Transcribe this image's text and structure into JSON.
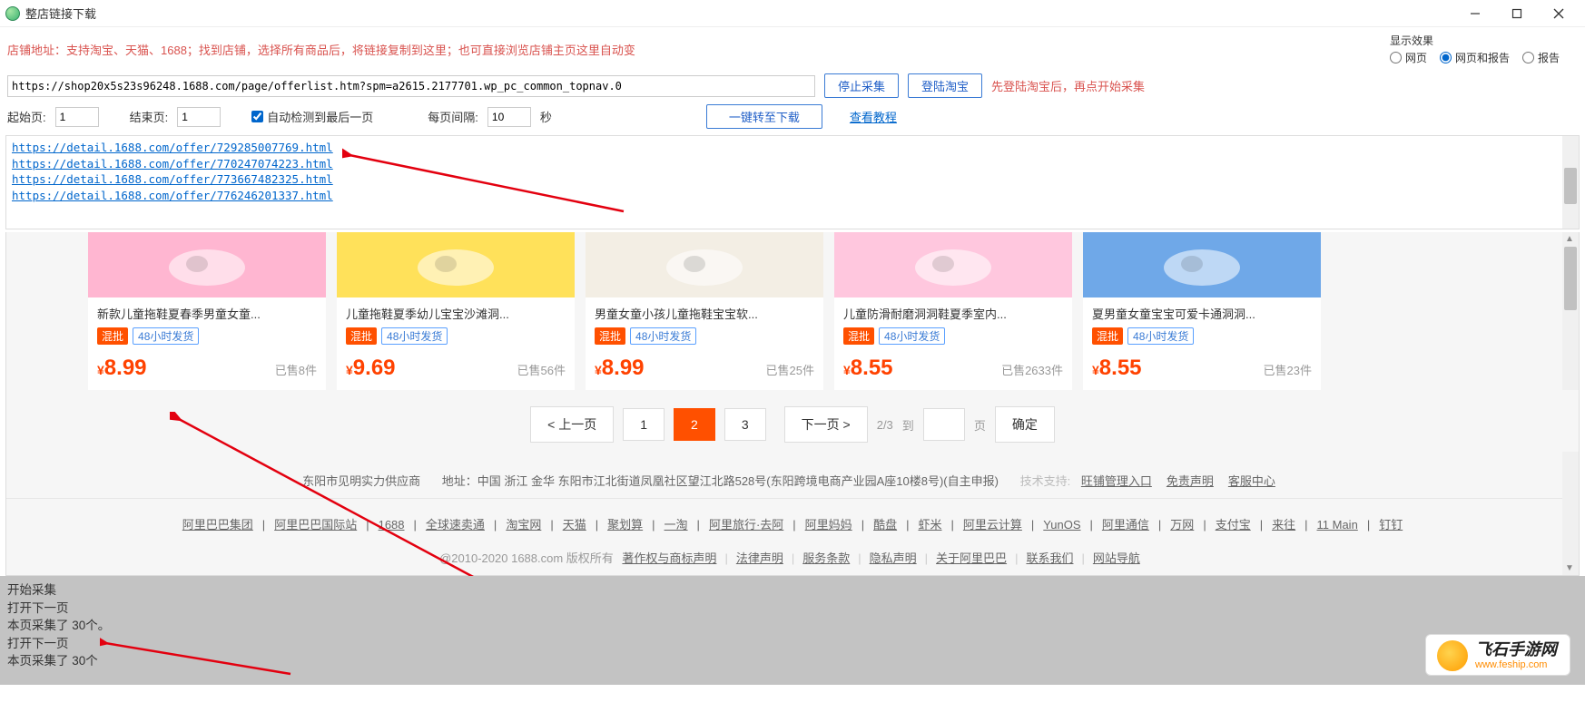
{
  "window": {
    "title": "整店链接下载"
  },
  "hint": "店铺地址：支持淘宝、天猫、1688；找到店铺，选择所有商品后，将链接复制到这里；也可直接浏览店铺主页这里自动变",
  "url_value": "https://shop20x5s23s96248.1688.com/page/offerlist.htm?spm=a2615.2177701.wp_pc_common_topnav.0",
  "buttons": {
    "stop": "停止采集",
    "login": "登陆淘宝",
    "transfer": "一键转至下载"
  },
  "login_hint": "先登陆淘宝后，再点开始采集",
  "display": {
    "label": "显示效果",
    "opt_web": "网页",
    "opt_web_report": "网页和报告",
    "opt_report": "报告",
    "selected": "opt_web_report"
  },
  "controls": {
    "start_page_label": "起始页:",
    "start_page": "1",
    "end_page_label": "结束页:",
    "end_page": "1",
    "auto_detect": "自动检测到最后一页",
    "interval_label": "每页间隔:",
    "interval": "10",
    "seconds": "秒",
    "view_tutorial": "查看教程"
  },
  "links": [
    "https://detail.1688.com/offer/776246201337.html",
    "https://detail.1688.com/offer/773667482325.html",
    "https://detail.1688.com/offer/770247074223.html",
    "https://detail.1688.com/offer/729285007769.html"
  ],
  "products": [
    {
      "title": "新款儿童拖鞋夏春季男童女童...",
      "tag1": "混批",
      "tag2": "48小时发货",
      "price": "8.99",
      "sold": "已售8件",
      "img": "pink"
    },
    {
      "title": "儿童拖鞋夏季幼儿宝宝沙滩洞...",
      "tag1": "混批",
      "tag2": "48小时发货",
      "price": "9.69",
      "sold": "已售56件",
      "img": "yellow"
    },
    {
      "title": "男童女童小孩儿童拖鞋宝宝软...",
      "tag1": "混批",
      "tag2": "48小时发货",
      "price": "8.99",
      "sold": "已售25件",
      "img": "white"
    },
    {
      "title": "儿童防滑耐磨洞洞鞋夏季室内...",
      "tag1": "混批",
      "tag2": "48小时发货",
      "price": "8.55",
      "sold": "已售2633件",
      "img": "pink2"
    },
    {
      "title": "夏男童女童宝宝可爱卡通洞洞...",
      "tag1": "混批",
      "tag2": "48小时发货",
      "price": "8.55",
      "sold": "已售23件",
      "img": "blue"
    }
  ],
  "pagination": {
    "prev": "< 上一页",
    "next": "下一页 >",
    "pages": [
      "1",
      "2",
      "3"
    ],
    "current": "2",
    "of": "2/3",
    "goto": "到",
    "page_suffix": "页",
    "confirm": "确定"
  },
  "footer": {
    "supplier": "东阳市见明实力供应商",
    "address_label": "地址：",
    "address": "中国 浙江 金华 东阳市江北街道凤凰社区望江北路528号(东阳跨境电商产业园A座10楼8号)(自主申报)",
    "tech_label": "技术支持:",
    "tech_links": [
      "旺铺管理入口",
      "免责声明",
      "客服中心"
    ]
  },
  "sitelinks": [
    "阿里巴巴集团",
    "阿里巴巴国际站",
    "1688",
    "全球速卖通",
    "淘宝网",
    "天猫",
    "聚划算",
    "一淘",
    "阿里旅行·去阿",
    "阿里妈妈",
    "酷盘",
    "虾米",
    "阿里云计算",
    "YunOS",
    "阿里通信",
    "万网",
    "支付宝",
    "来往",
    "11 Main",
    "钉钉"
  ],
  "copyright": {
    "text": "@2010-2020 1688.com 版权所有",
    "links": [
      "著作权与商标声明",
      "法律声明",
      "服务条款",
      "隐私声明",
      "关于阿里巴巴",
      "联系我们",
      "网站导航"
    ]
  },
  "log": [
    "开始采集",
    "打开下一页",
    "本页采集了 30个。",
    "打开下一页",
    "本页采集了 30个"
  ],
  "watermark": {
    "title": "飞石手游网",
    "sub": "www.feship.com"
  },
  "yen": "¥"
}
